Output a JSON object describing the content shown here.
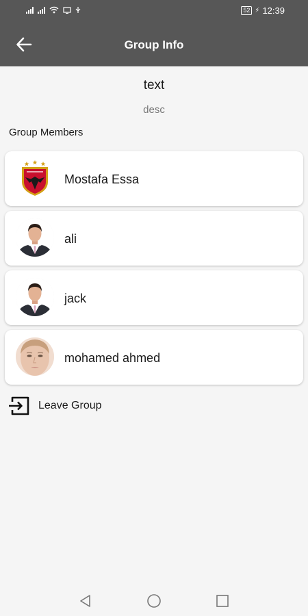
{
  "status_bar": {
    "battery": "52",
    "time": "12:39"
  },
  "app_bar": {
    "title": "Group Info"
  },
  "group": {
    "name": "text",
    "desc": "desc"
  },
  "members_section": {
    "label": "Group Members"
  },
  "members": [
    {
      "name": "Mostafa Essa",
      "avatar": "club-crest"
    },
    {
      "name": "ali",
      "avatar": "man-in-suit"
    },
    {
      "name": "jack",
      "avatar": "man-in-suit"
    },
    {
      "name": "mohamed ahmed",
      "avatar": "woman-face"
    }
  ],
  "actions": {
    "leave_label": "Leave Group"
  },
  "colors": {
    "app_bar": "#575757",
    "background": "#f5f5f5",
    "card": "#ffffff",
    "crest_red": "#c8102e",
    "crest_gold": "#d4a017"
  }
}
